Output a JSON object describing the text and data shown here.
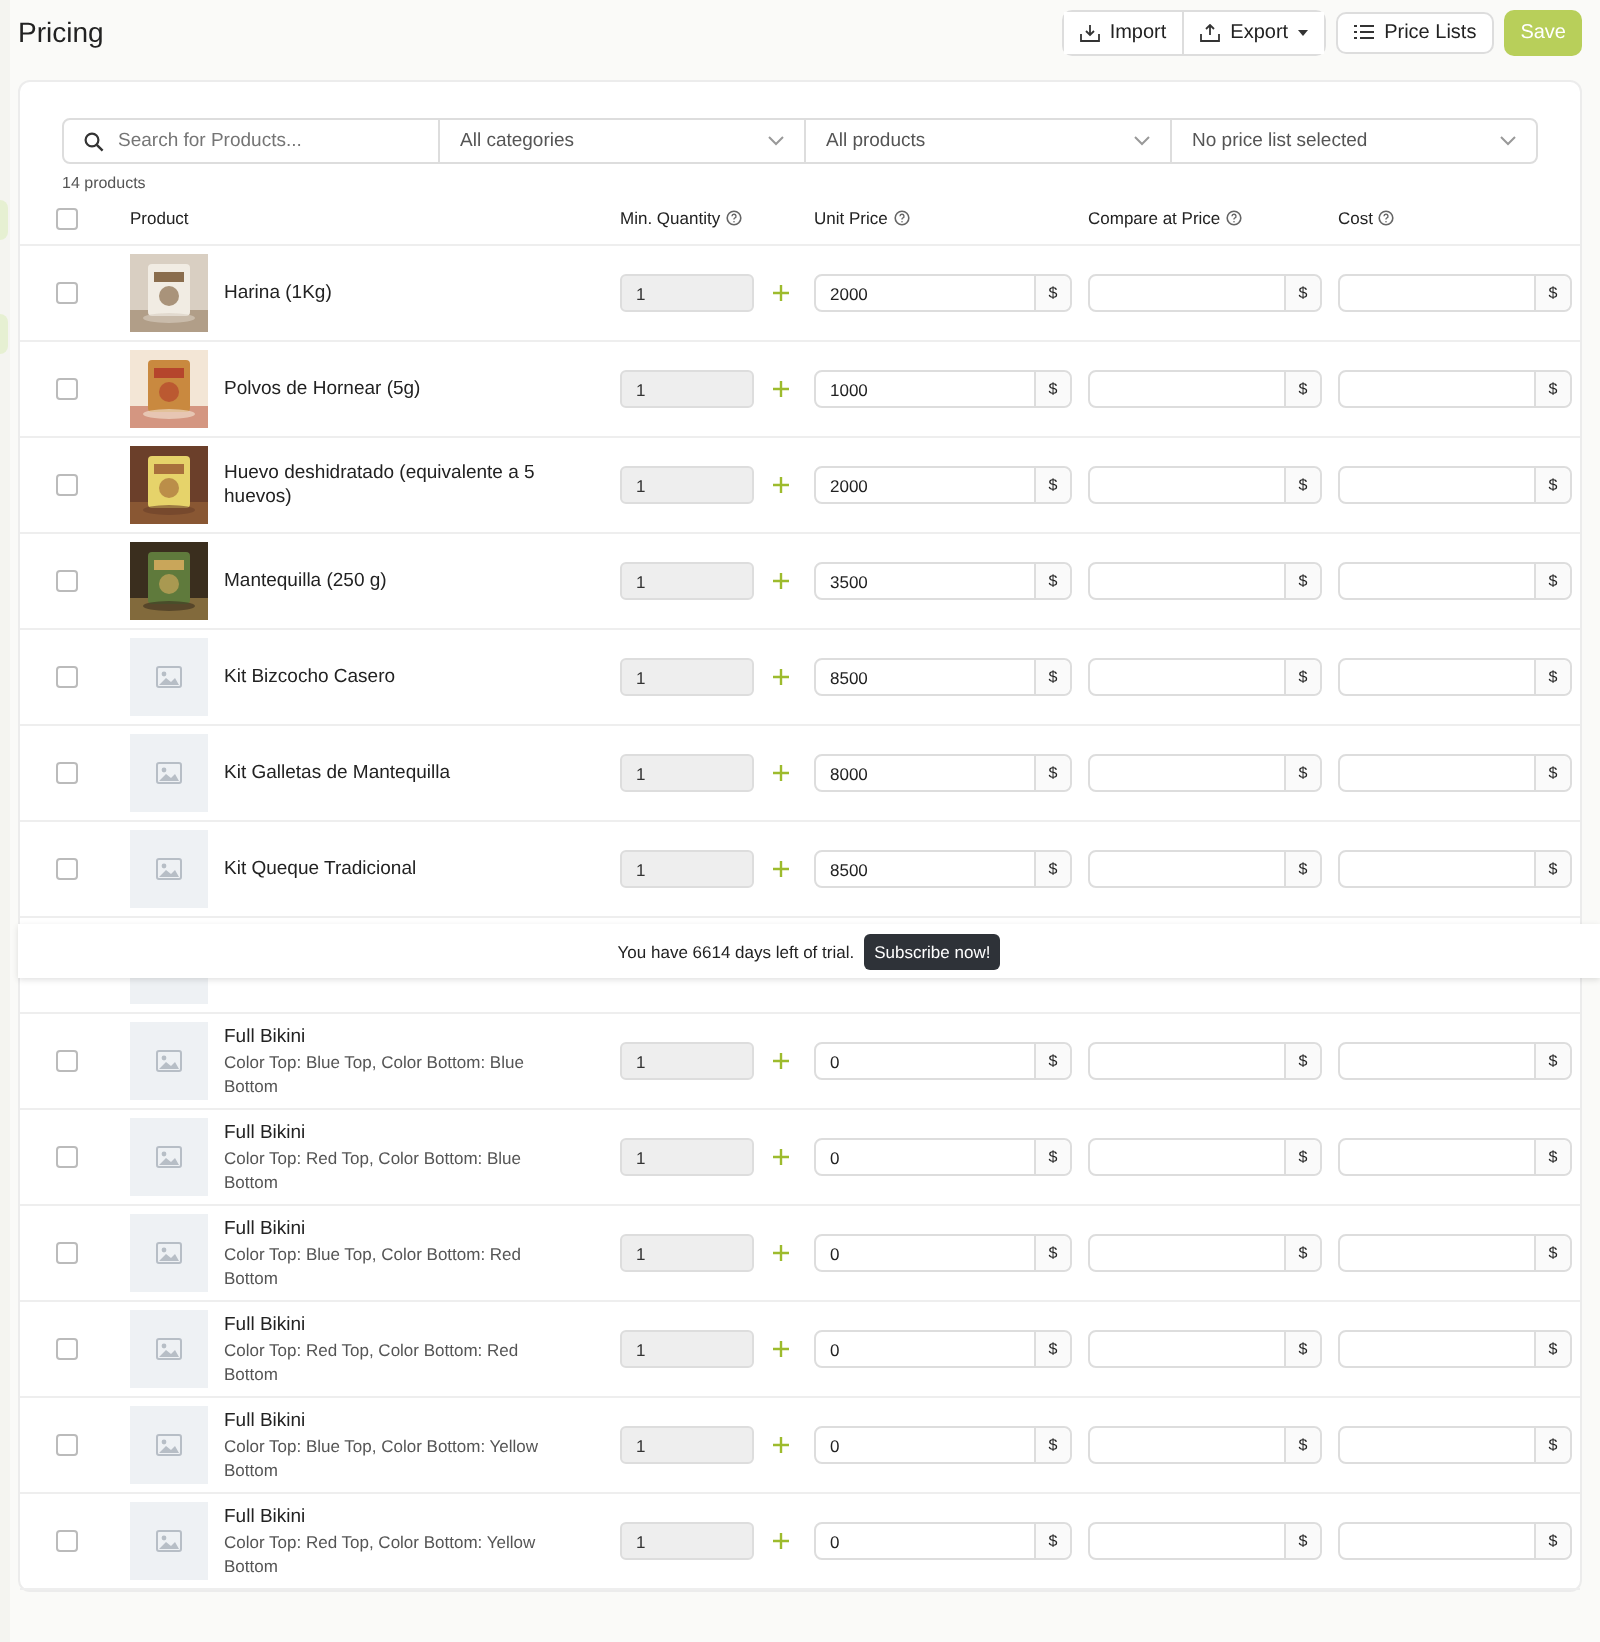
{
  "page": {
    "title": "Pricing"
  },
  "toolbar": {
    "import": "Import",
    "export": "Export",
    "price_lists": "Price Lists",
    "save": "Save"
  },
  "filters": {
    "search": {
      "placeholder": "Search for Products..."
    },
    "category": "All categories",
    "products": "All products",
    "price_list": "No price list selected"
  },
  "count": "14 products",
  "select_all": {
    "checked": false
  },
  "columns": {
    "product": "Product",
    "min_quantity": "Min. Quantity",
    "unit_price": "Unit Price",
    "compare_at_price": "Compare at Price",
    "cost": "Cost"
  },
  "currency": "$",
  "rows": [
    {
      "checked": false,
      "name": "Harina (1Kg)",
      "min_quantity": "1",
      "unit_price": "2000"
    },
    {
      "checked": false,
      "name": "Polvos de Hornear (5g)",
      "min_quantity": "1",
      "unit_price": "1000"
    },
    {
      "checked": false,
      "name": "Huevo deshidratado (equivalente a 5 huevos)",
      "min_quantity": "1",
      "unit_price": "2000"
    },
    {
      "checked": false,
      "name": "Mantequilla (250 g)",
      "min_quantity": "1",
      "unit_price": "3500"
    },
    {
      "kind": "product",
      "checked": false,
      "name": "Kit Bizcocho Casero",
      "min_quantity": "1",
      "unit_price": "8500"
    },
    {
      "kind": "product",
      "checked": false,
      "name": "Kit Galletas de Mantequilla",
      "min_quantity": "1",
      "unit_price": "8000"
    },
    {
      "kind": "product",
      "checked": false,
      "name": "Kit Queque Tradicional",
      "min_quantity": "1",
      "unit_price": "8500"
    },
    {
      "kind": "covered"
    },
    {
      "kind": "variant",
      "checked": false,
      "name": "Full Bikini",
      "variant": "Color Top: Blue Top, Color Bottom: Blue Bottom",
      "min_quantity": "1",
      "unit_price": "0"
    },
    {
      "kind": "variant",
      "checked": false,
      "name": "Full Bikini",
      "variant": "Color Top: Red Top, Color Bottom: Blue Bottom",
      "min_quantity": "1",
      "unit_price": "0"
    },
    {
      "kind": "variant",
      "checked": false,
      "name": "Full Bikini",
      "variant": "Color Top: Blue Top, Color Bottom: Red Bottom",
      "min_quantity": "1",
      "unit_price": "0"
    },
    {
      "kind": "variant",
      "checked": false,
      "name": "Full Bikini",
      "variant": "Color Top: Red Top, Color Bottom: Red Bottom",
      "min_quantity": "1",
      "unit_price": "0"
    },
    {
      "kind": "variant",
      "checked": false,
      "name": "Full Bikini",
      "variant": "Color Top: Blue Top, Color Bottom: Yellow Bottom",
      "min_quantity": "1",
      "unit_price": "0"
    },
    {
      "kind": "variant",
      "checked": false,
      "name": "Full Bikini",
      "variant": "Color Top: Red Top, Color Bottom: Yellow Bottom",
      "min_quantity": "1",
      "unit_price": "0"
    }
  ],
  "trial_banner": {
    "message": "You have 6614 days left of trial.",
    "button": "Subscribe now!"
  }
}
